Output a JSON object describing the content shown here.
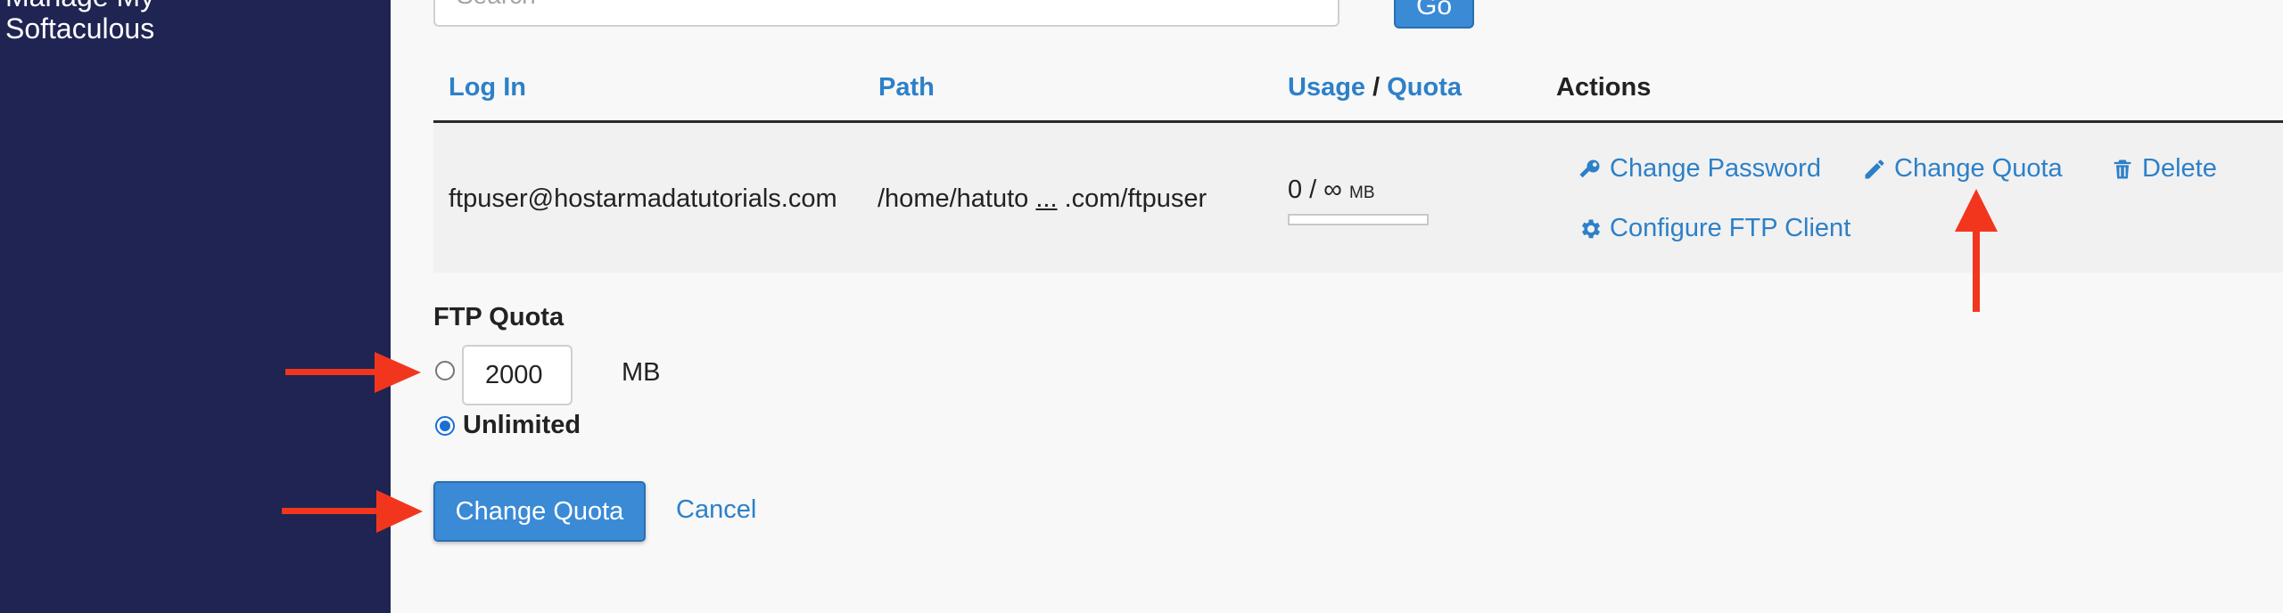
{
  "sidebar": {
    "clipped_item": "Manage My",
    "item": "Softaculous"
  },
  "search": {
    "placeholder": "Search",
    "go_label": "Go"
  },
  "table": {
    "headers": {
      "login": "Log In",
      "path": "Path",
      "usage": "Usage",
      "separator": "/",
      "quota": "Quota",
      "actions": "Actions"
    },
    "row": {
      "login": "ftpuser@hostarmadatutorials.com",
      "path_start": "/home/hatuto",
      "path_ellipsis": "...",
      "path_end": ".com/ftpuser",
      "usage_value": "0 / ∞",
      "usage_unit": "MB",
      "usage_fraction": 0,
      "actions": {
        "change_password": "Change Password",
        "change_quota": "Change Quota",
        "delete": "Delete",
        "configure_client": "Configure FTP Client"
      }
    }
  },
  "quota_form": {
    "label": "FTP Quota",
    "limit_value": "2000",
    "limit_unit": "MB",
    "unlimited_label": "Unlimited",
    "selected": "unlimited",
    "submit_label": "Change Quota",
    "cancel_label": "Cancel"
  },
  "colors": {
    "sidebar_bg": "#1f2452",
    "link": "#2d80c8",
    "primary_button": "#3a8ad6",
    "annotation_arrow": "#f2361d"
  },
  "icons": {
    "change_password": "key-icon",
    "change_quota": "pencil-icon",
    "delete": "trash-icon",
    "configure_client": "gear-icon"
  }
}
